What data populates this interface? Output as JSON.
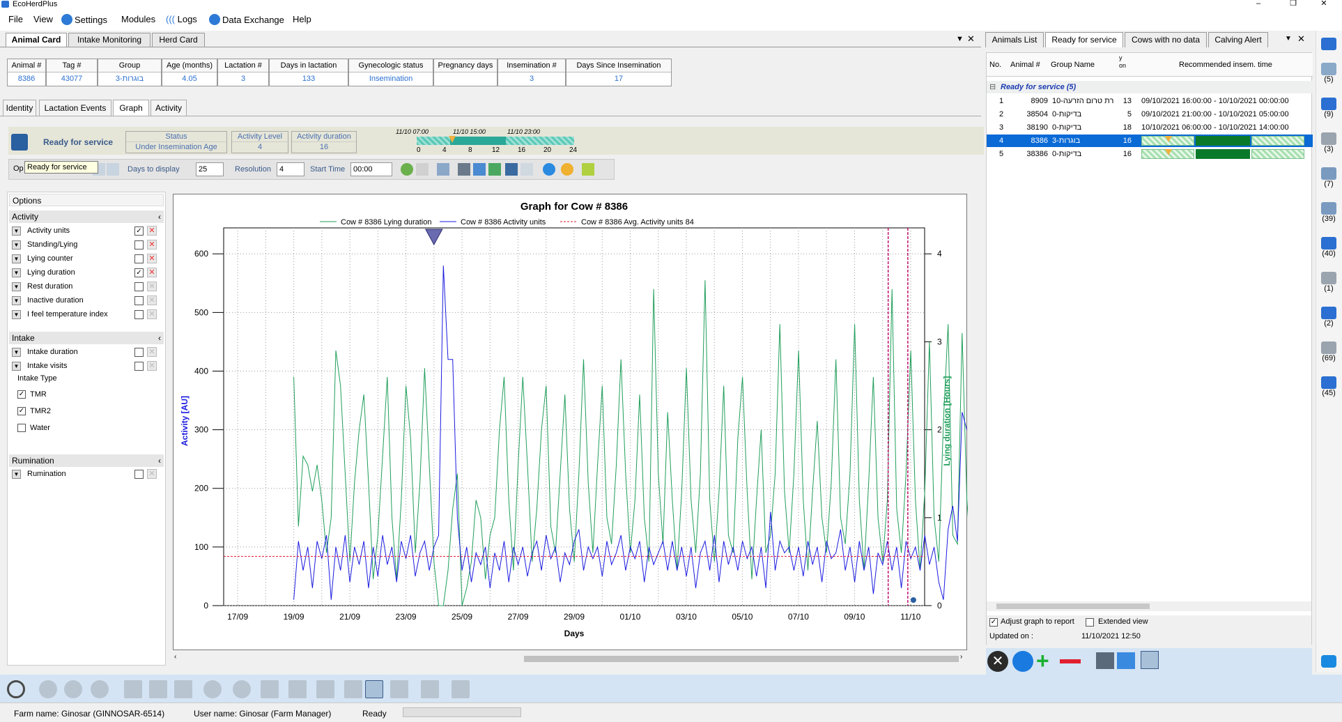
{
  "app": {
    "title": "EcoHerdPlus"
  },
  "window": {
    "minimize": "–",
    "maximize": "❐",
    "close": "✕"
  },
  "menu": [
    "File",
    "View",
    "Settings",
    "Modules",
    "Logs",
    "Data Exchange",
    "Help"
  ],
  "main_tabs": [
    "Animal Card",
    "Intake Monitoring",
    "Herd Card"
  ],
  "animal_header": {
    "columns": [
      {
        "label": "Animal #",
        "value": "8386"
      },
      {
        "label": "Tag #",
        "value": "43077"
      },
      {
        "label": "Group",
        "value": "3-בוגרות"
      },
      {
        "label": "Age (months)",
        "value": "4.05"
      },
      {
        "label": "Lactation #",
        "value": "3"
      },
      {
        "label": "Days in lactation",
        "value": "133"
      },
      {
        "label": "Gynecologic status",
        "value": "Insemination"
      },
      {
        "label": "Pregnancy days",
        "value": ""
      },
      {
        "label": "Insemination #",
        "value": "3"
      },
      {
        "label": "Days Since Insemination",
        "value": "17"
      }
    ]
  },
  "sub_tabs": [
    "Identity",
    "Lactation Events",
    "Graph",
    "Activity"
  ],
  "status_strip": {
    "title": "Ready for service",
    "status_label": "Status",
    "status_value": "Under Insemination Age",
    "activity_level_label": "Activity Level",
    "activity_level_value": "4",
    "activity_duration_label": "Activity duration",
    "activity_duration_value": "16",
    "timeline_times": [
      "11/10 07:00",
      "11/10 15:00",
      "11/10 23:00"
    ],
    "timeline_ticks": [
      "0",
      "4",
      "8",
      "12",
      "16",
      "20",
      "24"
    ]
  },
  "toolbar": {
    "tooltip": "Ready for service",
    "options_short": "Op",
    "days_label": "Days to display",
    "days_value": "25",
    "resolution_label": "Resolution",
    "resolution_value": "4",
    "start_time_label": "Start Time",
    "start_time_value": "00:00"
  },
  "options": {
    "title": "Options",
    "activity_header": "Activity",
    "activity_items": [
      {
        "name": "Activity units",
        "checked": true,
        "x": "active"
      },
      {
        "name": "Standing/Lying",
        "checked": false,
        "x": "active"
      },
      {
        "name": "Lying counter",
        "checked": false,
        "x": "active"
      },
      {
        "name": "Lying duration",
        "checked": true,
        "x": "active"
      },
      {
        "name": "Rest duration",
        "checked": false,
        "x": "dim"
      },
      {
        "name": "Inactive duration",
        "checked": false,
        "x": "dim"
      },
      {
        "name": "I feel temperature index",
        "checked": false,
        "x": "dim"
      }
    ],
    "intake_header": "Intake",
    "intake_items": [
      {
        "name": "Intake duration",
        "checked": false
      },
      {
        "name": "Intake visits",
        "checked": false
      }
    ],
    "intake_type_label": "Intake Type",
    "intake_types": [
      {
        "name": "TMR",
        "checked": true
      },
      {
        "name": "TMR2",
        "checked": true
      },
      {
        "name": "Water",
        "checked": false
      }
    ],
    "rumination_header": "Rumination",
    "rumination_items": [
      {
        "name": "Rumination",
        "checked": false
      }
    ]
  },
  "chart_data": {
    "type": "line",
    "title": "Graph for Cow # 8386",
    "xlabel": "Days",
    "ylabel": "Activity [AU]",
    "y2label": "Lying duration [Hours]",
    "x_ticks": [
      "17/09",
      "19/09",
      "21/09",
      "23/09",
      "25/09",
      "27/09",
      "29/09",
      "01/10",
      "03/10",
      "05/10",
      "07/10",
      "09/10",
      "11/10"
    ],
    "ylim": [
      0,
      630
    ],
    "y_ticks": [
      0,
      100,
      200,
      300,
      400,
      500,
      600
    ],
    "y2lim": [
      0,
      4.2
    ],
    "y2_ticks": [
      0,
      1,
      2,
      3,
      4
    ],
    "x_range_days": [
      -0.5,
      24.5
    ],
    "grid": true,
    "legend_position": "top",
    "series": [
      {
        "name": "Cow # 8386 Lying duration",
        "color": "#1f9e5a",
        "axis": "right",
        "x_start": 2,
        "x_step": 0.1667,
        "values": [
          2.6,
          0.9,
          1.7,
          1.6,
          1.3,
          1.6,
          1.2,
          0.6,
          1.0,
          2.9,
          2.5,
          1.5,
          0.5,
          1.4,
          2.0,
          2.4,
          1.4,
          0.3,
          0.8,
          1.7,
          2.6,
          1.0,
          0.3,
          1.2,
          2.5,
          1.9,
          0.6,
          1.4,
          2.7,
          1.6,
          0.5,
          0.0,
          0.0,
          0.4,
          1.1,
          1.5,
          0.0,
          0.2,
          0.5,
          1.2,
          1.0,
          0.3,
          0.8,
          1.0,
          2.0,
          2.6,
          1.2,
          0.4,
          1.6,
          2.6,
          1.6,
          0.5,
          1.1,
          2.0,
          2.5,
          0.9,
          0.6,
          1.5,
          2.4,
          1.1,
          0.5,
          1.5,
          2.8,
          1.4,
          0.6,
          1.6,
          2.5,
          1.0,
          0.7,
          1.6,
          2.8,
          1.5,
          0.6,
          1.2,
          2.4,
          1.0,
          0.5,
          3.6,
          1.5,
          0.7,
          2.2,
          1.2,
          0.4,
          1.3,
          2.7,
          1.2,
          0.6,
          1.5,
          3.7,
          1.2,
          0.5,
          1.3,
          2.5,
          0.8,
          0.6,
          1.9,
          2.6,
          1.3,
          0.3,
          1.2,
          2.0,
          0.6,
          0.8,
          1.5,
          3.2,
          1.3,
          0.6,
          1.5,
          2.9,
          1.2,
          0.4,
          1.3,
          2.1,
          1.0,
          0.6,
          1.4,
          2.8,
          1.0,
          0.7,
          1.5,
          3.2,
          1.2,
          0.4,
          1.4,
          2.6,
          1.0,
          0.5,
          1.2,
          3.6,
          1.1,
          0.6,
          1.5,
          2.9,
          1.2,
          0.4,
          1.3,
          3.0,
          1.0,
          0.5,
          2.1,
          3.2,
          0.8,
          0.7,
          3.1,
          1.2,
          0.5,
          1.3,
          1.5,
          0.9,
          1.6
        ]
      },
      {
        "name": "Cow # 8386 Activity units",
        "color": "#1a1ae0",
        "axis": "left",
        "x_start": 2,
        "x_step": 0.1667,
        "values": [
          10,
          110,
          60,
          100,
          30,
          110,
          80,
          120,
          10,
          100,
          60,
          120,
          40,
          100,
          70,
          110,
          30,
          100,
          50,
          120,
          70,
          100,
          40,
          110,
          80,
          120,
          50,
          90,
          110,
          60,
          100,
          120,
          580,
          420,
          420,
          150,
          60,
          100,
          40,
          90,
          70,
          100,
          30,
          90,
          60,
          110,
          40,
          100,
          70,
          100,
          50,
          90,
          110,
          60,
          120,
          80,
          100,
          40,
          90,
          70,
          110,
          130,
          60,
          100,
          80,
          100,
          50,
          110,
          70,
          90,
          120,
          60,
          100,
          80,
          110,
          40,
          100,
          70,
          90,
          110,
          60,
          110,
          60,
          100,
          50,
          100,
          30,
          90,
          110,
          60,
          120,
          40,
          110,
          70,
          100,
          60,
          110,
          80,
          100,
          50,
          100,
          30,
          160,
          60,
          110,
          90,
          100,
          60,
          100,
          50,
          110,
          70,
          100,
          40,
          110,
          80,
          90,
          130,
          60,
          100,
          40,
          110,
          60,
          100,
          20,
          90,
          70,
          110,
          60,
          100,
          30,
          110,
          80,
          100,
          60,
          120,
          70,
          100,
          40,
          10,
          130,
          170,
          110,
          330,
          300
        ]
      },
      {
        "name": "Cow # 8386 Avg. Activity units 84",
        "color": "#e01030",
        "axis": "left",
        "constant": 84
      }
    ],
    "annotations": [
      {
        "type": "marker_triangle",
        "x": 7.0,
        "label": ""
      },
      {
        "type": "vline",
        "x": 23.2,
        "color": "#c0106a"
      },
      {
        "type": "vline",
        "x": 23.9,
        "color": "#c0106a"
      }
    ]
  },
  "right_panel": {
    "tabs": [
      "Animals List",
      "Ready for service",
      "Cows with no data",
      "Calving Alert"
    ],
    "columns": [
      "No.",
      "Animal #",
      "Group Name",
      "y on",
      "Recommended insem. time"
    ],
    "group_title": "Ready for service (5)",
    "rows": [
      {
        "no": "1",
        "animal": "8909",
        "group": "10-רת טרום הזרעה",
        "days": "13",
        "time": "09/10/2021 16:00:00 - 10/10/2021 00:00:00",
        "selected": false,
        "bars": false
      },
      {
        "no": "2",
        "animal": "38504",
        "group": "0-בדיקות",
        "days": "5",
        "time": "09/10/2021 21:00:00 - 10/10/2021 05:00:00",
        "selected": false,
        "bars": false
      },
      {
        "no": "3",
        "animal": "38190",
        "group": "0-בדיקות",
        "days": "18",
        "time": "10/10/2021 06:00:00 - 10/10/2021 14:00:00",
        "selected": false,
        "bars": false
      },
      {
        "no": "4",
        "animal": "8386",
        "group": "3-בוגרות",
        "days": "16",
        "time": "",
        "selected": true,
        "bars": true
      },
      {
        "no": "5",
        "animal": "38386",
        "group": "0-בדיקות",
        "days": "16",
        "time": "",
        "selected": false,
        "bars": true
      }
    ],
    "adjust_graph_label": "Adjust graph to report",
    "adjust_graph_checked": true,
    "extended_view_label": "Extended view",
    "extended_view_checked": false,
    "updated_label": "Updated on :",
    "updated_value": "11/10/2021 12:50"
  },
  "right_sidebar": {
    "counts": [
      "(5)",
      "(9)",
      "(3)",
      "(7)",
      "(39)",
      "(40)",
      "(1)",
      "(2)",
      "(69)",
      "(45)"
    ]
  },
  "statusbar": {
    "farm": "Farm name: Ginosar (GINNOSAR-6514)",
    "user": "User name: Ginosar (Farm Manager)",
    "state": "Ready"
  }
}
